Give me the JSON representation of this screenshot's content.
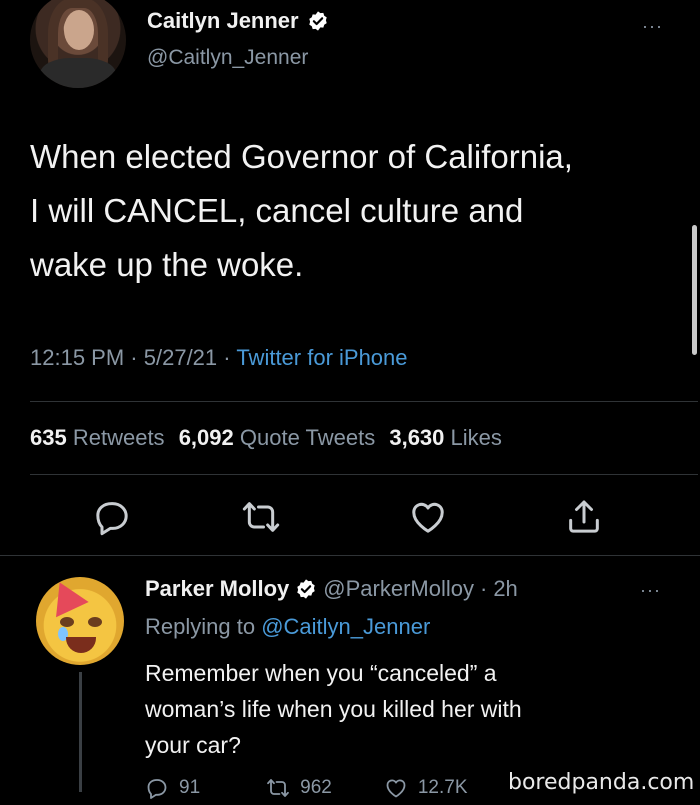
{
  "tweet": {
    "display_name": "Caitlyn Jenner",
    "handle": "@Caitlyn_Jenner",
    "more": "···",
    "text_lines": [
      "When elected Governor of California,",
      "I will CANCEL, cancel culture and",
      "wake up the woke."
    ],
    "time": "12:15 PM",
    "date": "5/27/21",
    "source": "Twitter for iPhone",
    "stats": {
      "retweets_count": "635",
      "retweets_label": "Retweets",
      "quotes_count": "6,092",
      "quotes_label": "Quote Tweets",
      "likes_count": "3,630",
      "likes_label": "Likes"
    },
    "actions": [
      "reply-icon",
      "retweet-icon",
      "like-icon",
      "share-icon"
    ]
  },
  "reply": {
    "display_name": "Parker Molloy",
    "handle": "@ParkerMolloy",
    "age": "2h",
    "more": "···",
    "replying_prefix": "Replying to",
    "replying_handle": "@Caitlyn_Jenner",
    "text_lines": [
      "Remember when you “canceled” a",
      "woman’s life when you killed her with",
      "your car?"
    ],
    "counts": {
      "replies": "91",
      "retweets": "962",
      "likes": "12.7K"
    }
  },
  "watermark": "boredpanda.com",
  "colors": {
    "background": "#000000",
    "text": "#e7e9ea",
    "muted": "#8b98a5",
    "link": "#4a9ad8",
    "verified": "#ffffff"
  }
}
